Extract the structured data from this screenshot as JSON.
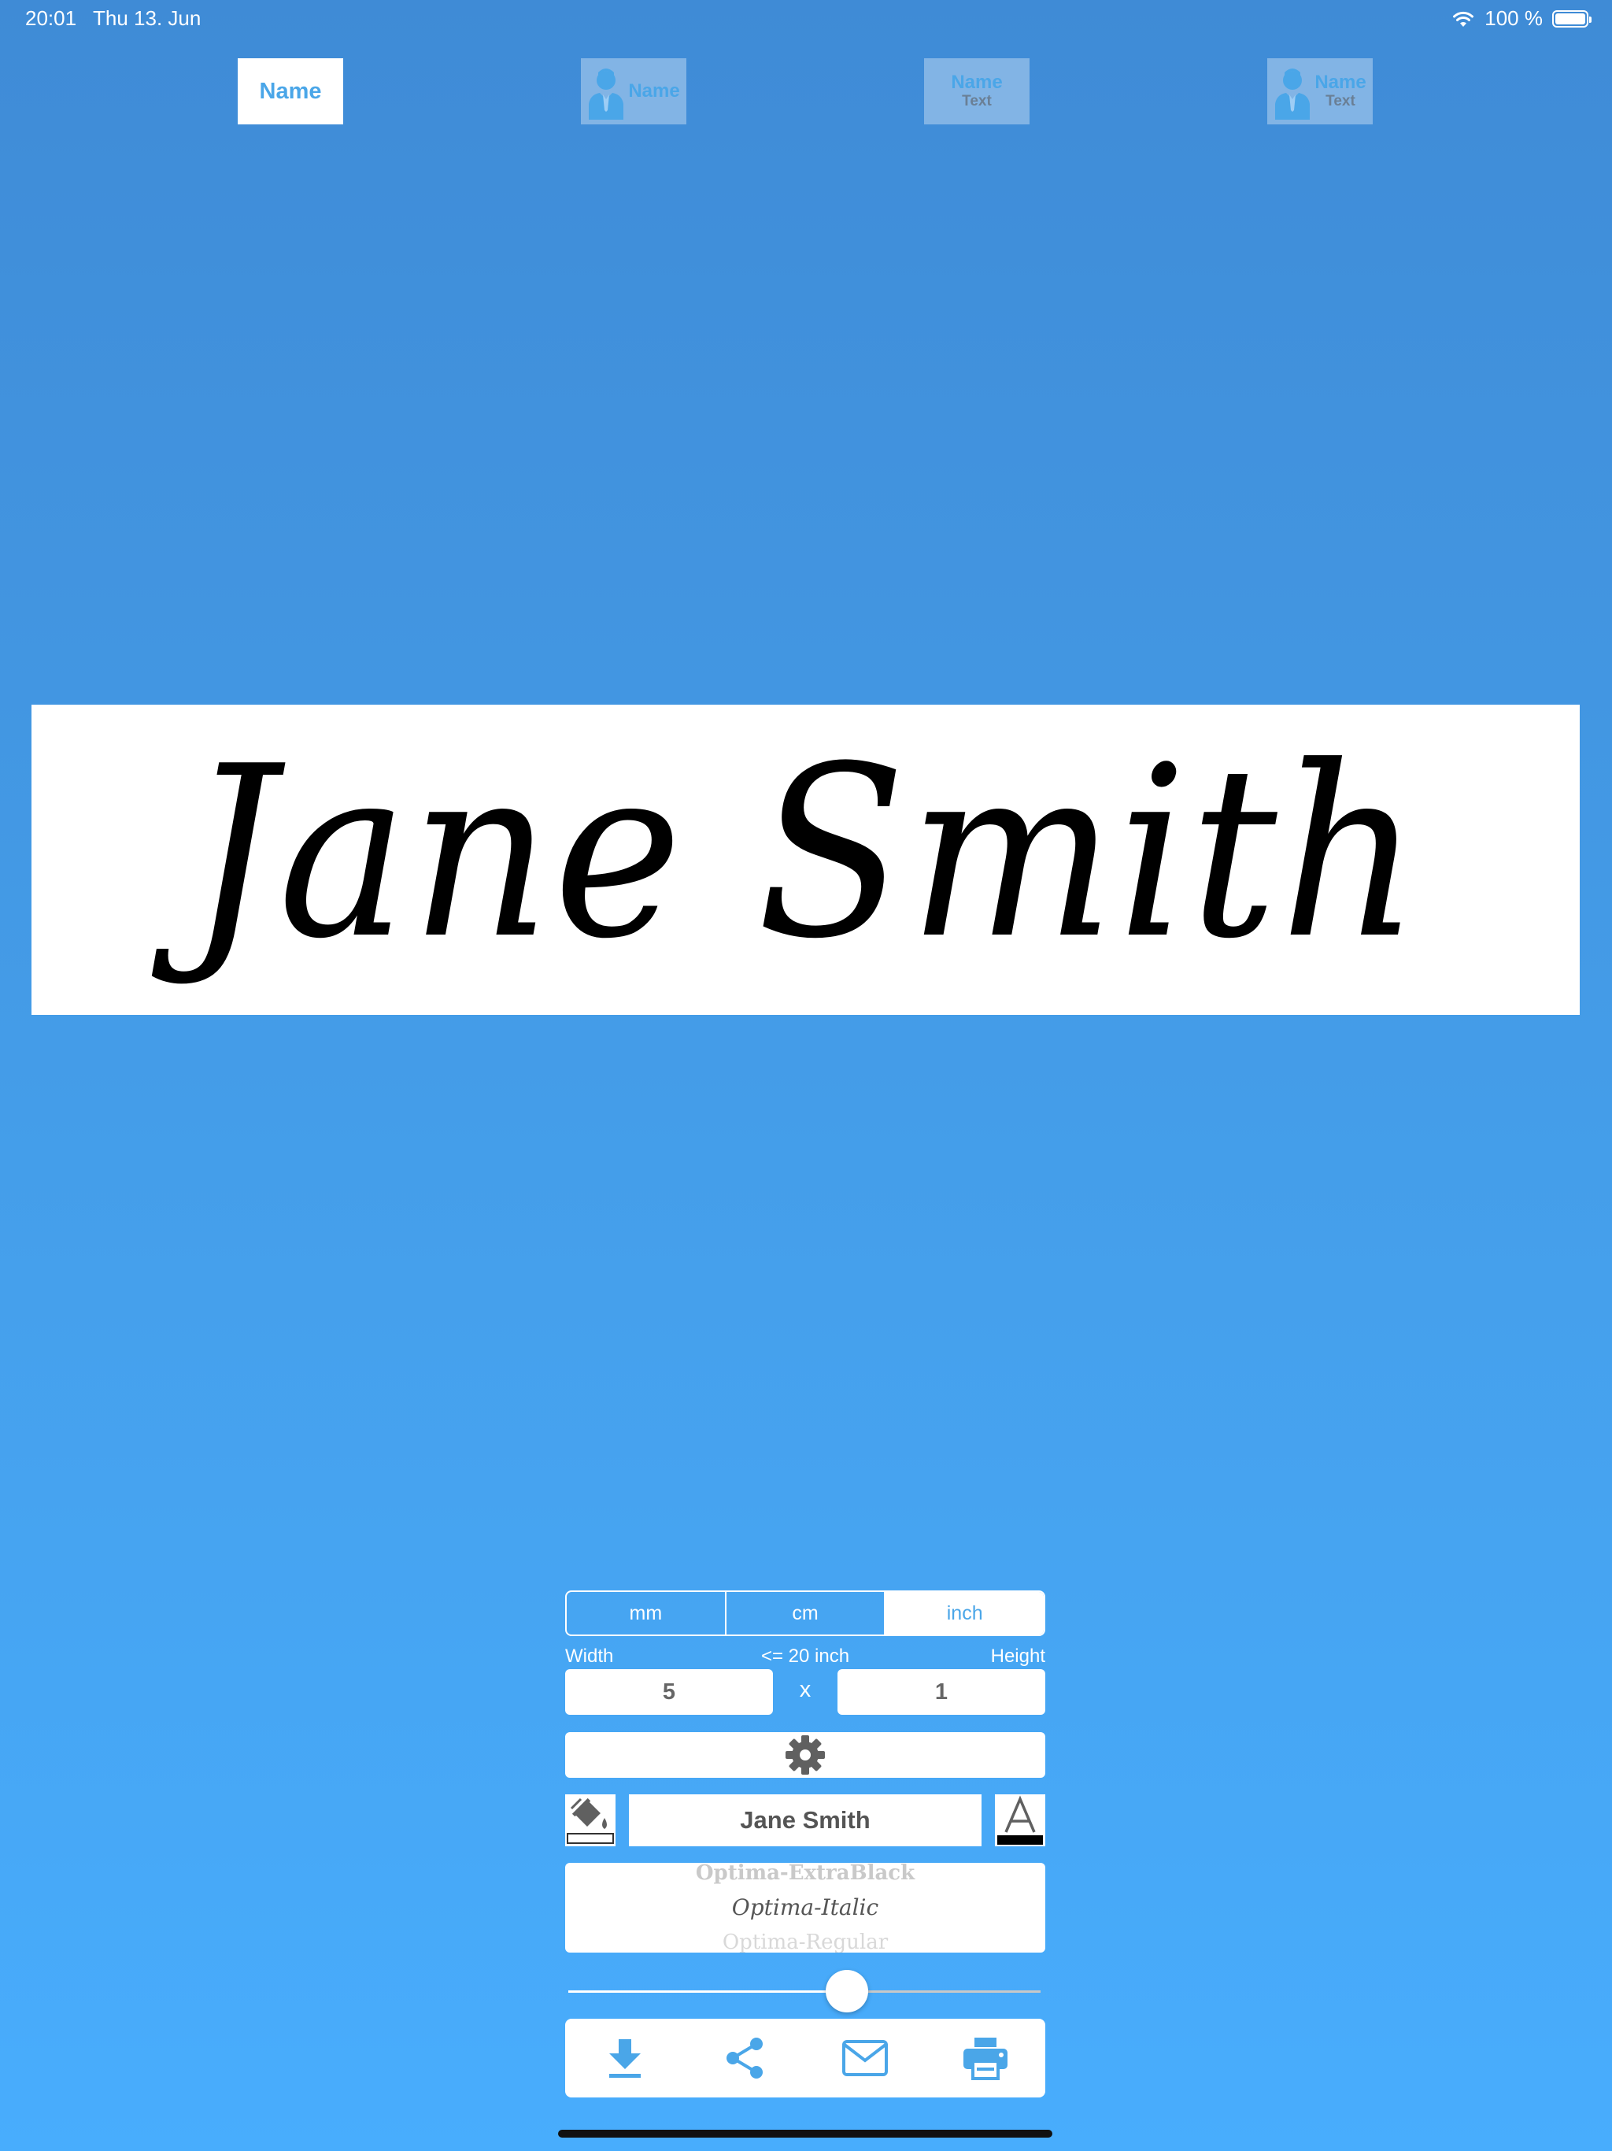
{
  "status_bar": {
    "time": "20:01",
    "date": "Thu 13. Jun",
    "battery": "100 %"
  },
  "templates": [
    {
      "label": "Name",
      "sub": "",
      "has_person": false,
      "active": true
    },
    {
      "label": "Name",
      "sub": "",
      "has_person": true,
      "active": false
    },
    {
      "label": "Name",
      "sub": "Text",
      "has_person": false,
      "active": false
    },
    {
      "label": "Name",
      "sub": "Text",
      "has_person": true,
      "active": false
    }
  ],
  "preview": {
    "text": "Jane Smith"
  },
  "units": {
    "options": [
      "mm",
      "cm",
      "inch"
    ],
    "selected": "inch"
  },
  "dimensions": {
    "width_label": "Width",
    "limit_label": "<= 20 inch",
    "height_label": "Height",
    "width": "5",
    "separator": "x",
    "height": "1"
  },
  "name_field": {
    "value": "Jane Smith"
  },
  "font_picker": {
    "above": "Optima-ExtraBlack",
    "selected": "Optima-Italic",
    "below": "Optima-Regular"
  },
  "size_slider": {
    "value": 0.59
  },
  "colors": {
    "accent": "#4aa6e8",
    "background_top": "#3f8bd6",
    "background_bottom": "#48adfd",
    "text_color": "#000000",
    "background_color": "#ffffff"
  },
  "actions": [
    {
      "name": "download-icon"
    },
    {
      "name": "share-icon"
    },
    {
      "name": "mail-icon"
    },
    {
      "name": "print-icon"
    }
  ]
}
